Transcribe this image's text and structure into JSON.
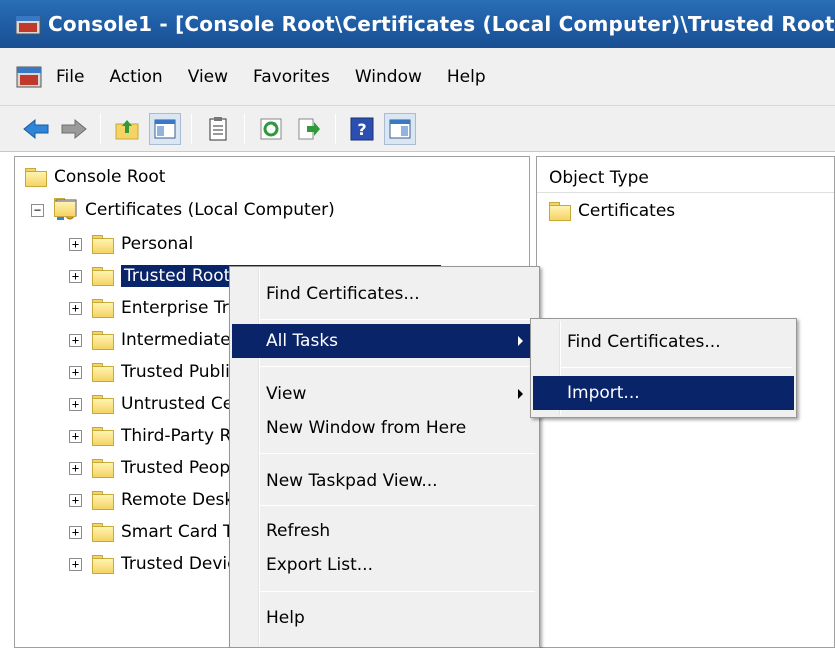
{
  "window": {
    "title": "Console1 - [Console Root\\Certificates (Local Computer)\\Trusted Root"
  },
  "menubar": {
    "items": [
      "File",
      "Action",
      "View",
      "Favorites",
      "Window",
      "Help"
    ]
  },
  "toolbar": {
    "buttons": [
      "back-icon",
      "forward-icon",
      "up-folder-icon",
      "show-hide-tree-icon",
      "properties-icon",
      "refresh-icon",
      "export-list-icon",
      "help-icon",
      "show-action-pane-icon"
    ]
  },
  "tree": {
    "root": "Console Root",
    "certificates": "Certificates (Local Computer)",
    "items": [
      "Personal",
      "Trusted Root Certification Authorities",
      "Enterprise Trust",
      "Intermediate Certification Authorities",
      "Trusted Publishers",
      "Untrusted Certificates",
      "Third-Party Root Certification Authorities",
      "Trusted People",
      "Remote Desktop",
      "Smart Card Trusted Roots",
      "Trusted Devices"
    ],
    "expander_plus": "+",
    "expander_minus": "−"
  },
  "right_pane": {
    "column_header": "Object Type",
    "items": [
      "Certificates"
    ]
  },
  "context_menu": {
    "find_certificates": "Find Certificates...",
    "all_tasks": "All Tasks",
    "view": "View",
    "new_window": "New Window from Here",
    "new_taskpad": "New Taskpad View...",
    "refresh": "Refresh",
    "export_list": "Export List...",
    "help": "Help"
  },
  "submenu": {
    "find_certificates": "Find Certificates...",
    "import": "Import..."
  },
  "colors": {
    "selection": "#0a246a",
    "titlebar": "#1f5fa8"
  }
}
